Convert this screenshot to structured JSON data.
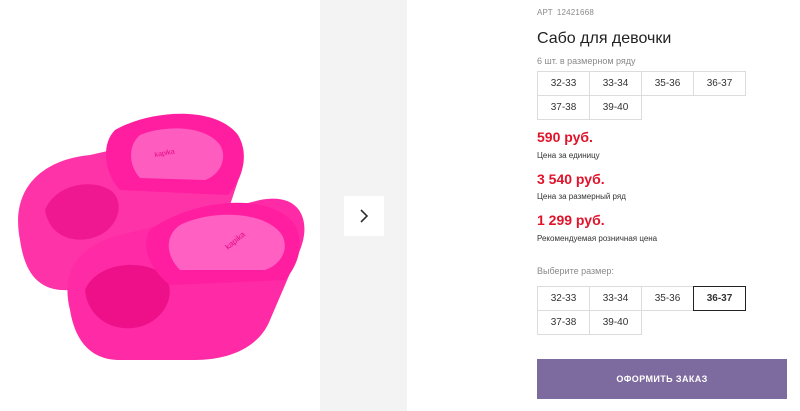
{
  "product": {
    "sku_label": "АРТ",
    "sku_value": "12421668",
    "title": "Сабо для девочки",
    "pack_label": "6 шт. в размерном ряду",
    "pack_sizes": [
      "32-33",
      "33-34",
      "35-36",
      "36-37",
      "37-38",
      "39-40"
    ],
    "image_alt": "pink-slide-sandals"
  },
  "prices": {
    "unit_price": "590 руб.",
    "unit_label": "Цена за единицу",
    "row_price": "3 540 руб.",
    "row_label": "Цена за размерный ряд",
    "retail_price": "1 299 руб.",
    "retail_label": "Рекомендуемая розничная цена"
  },
  "size_select": {
    "label": "Выберите размер:",
    "sizes": [
      "32-33",
      "33-34",
      "35-36",
      "36-37",
      "37-38",
      "39-40"
    ],
    "selected": "36-37"
  },
  "order_button_label": "ОФОРМИТЬ ЗАКАЗ",
  "colors": {
    "price": "#e0132a",
    "button": "#7d6a9e",
    "product": "#ff2aa6"
  },
  "icons": {
    "next": "chevron-right-icon"
  }
}
